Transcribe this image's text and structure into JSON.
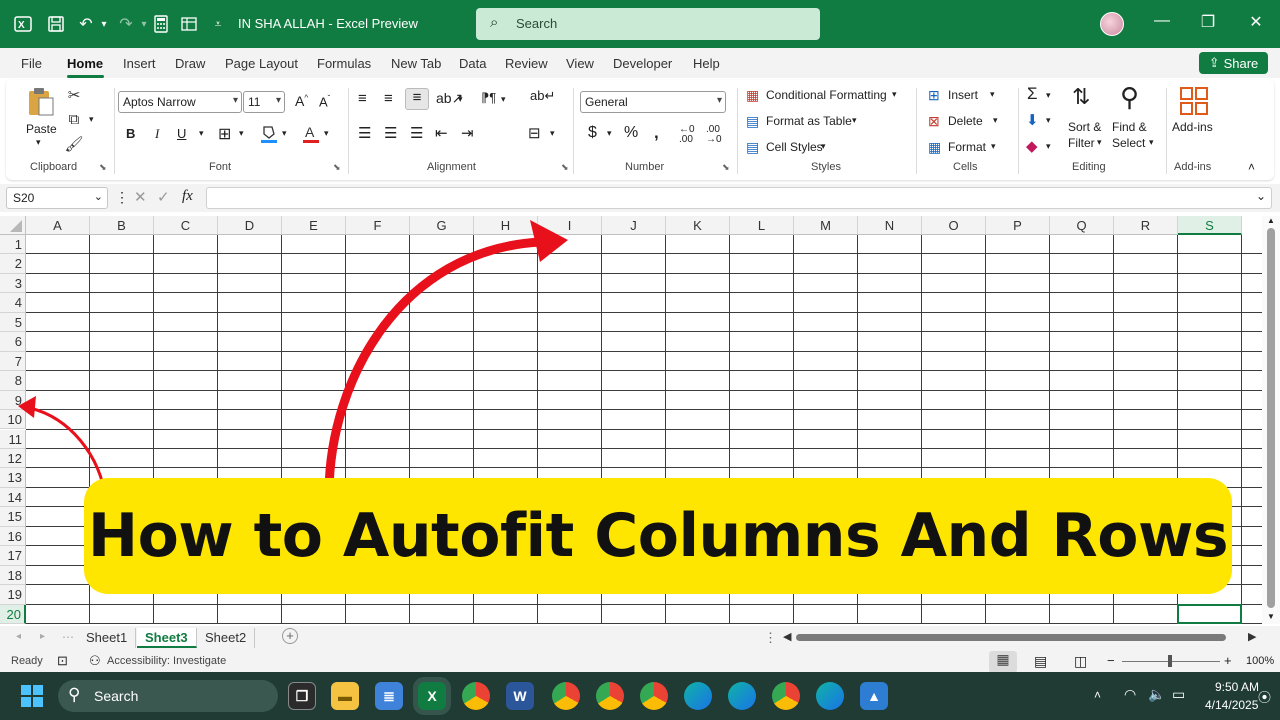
{
  "window": {
    "doc_title": "IN SHA ALLAH  -  Excel Preview",
    "search_placeholder": "Search",
    "minimize_glyph": "—",
    "restore_glyph": "❐",
    "close_glyph": "✕"
  },
  "menu": {
    "tabs": [
      "File",
      "Home",
      "Insert",
      "Draw",
      "Page Layout",
      "Formulas",
      "New Tab",
      "Data",
      "Review",
      "View",
      "Developer",
      "Help"
    ],
    "active": "Home",
    "share_label": "Share"
  },
  "ribbon": {
    "clipboard": {
      "label": "Clipboard",
      "paste": "Paste"
    },
    "font": {
      "label": "Font",
      "family": "Aptos Narrow",
      "size": "11"
    },
    "alignment": {
      "label": "Alignment"
    },
    "number": {
      "label": "Number",
      "format": "General"
    },
    "styles": {
      "label": "Styles",
      "conditional": "Conditional Formatting",
      "format_table": "Format as Table",
      "cell_styles": "Cell Styles"
    },
    "cells": {
      "label": "Cells",
      "insert": "Insert",
      "delete": "Delete",
      "format": "Format"
    },
    "editing": {
      "label": "Editing",
      "sort_1": "Sort &",
      "sort_2": "Filter",
      "find_1": "Find &",
      "find_2": "Select"
    },
    "addins": {
      "label": "Add-ins",
      "addins_btn": "Add-ins"
    }
  },
  "formula_bar": {
    "name_box": "S20",
    "fx": "fx",
    "value": ""
  },
  "grid": {
    "columns": [
      "A",
      "B",
      "C",
      "D",
      "E",
      "F",
      "G",
      "H",
      "I",
      "J",
      "K",
      "L",
      "M",
      "N",
      "O",
      "P",
      "Q",
      "R",
      "S"
    ],
    "rows": [
      "1",
      "2",
      "3",
      "4",
      "5",
      "6",
      "7",
      "8",
      "9",
      "10",
      "11",
      "12",
      "13",
      "14",
      "15",
      "16",
      "17",
      "18",
      "19",
      "20"
    ],
    "selected_column": "S",
    "selected_row": "20"
  },
  "sheets": {
    "tabs": [
      "Sheet1",
      "Sheet3",
      "Sheet2"
    ],
    "active": "Sheet3",
    "add": "+"
  },
  "status": {
    "ready": "Ready",
    "accessibility": "Accessibility: Investigate",
    "zoom": "100%"
  },
  "taskbar": {
    "search": "Search",
    "time": "9:50 AM",
    "date": "4/14/2025"
  },
  "overlay": {
    "banner_text": "How to Autofit Columns And Rows",
    "banner_color": "#ffe600",
    "arrow_color": "#e8101b"
  },
  "colors": {
    "excel_green": "#107c41"
  }
}
